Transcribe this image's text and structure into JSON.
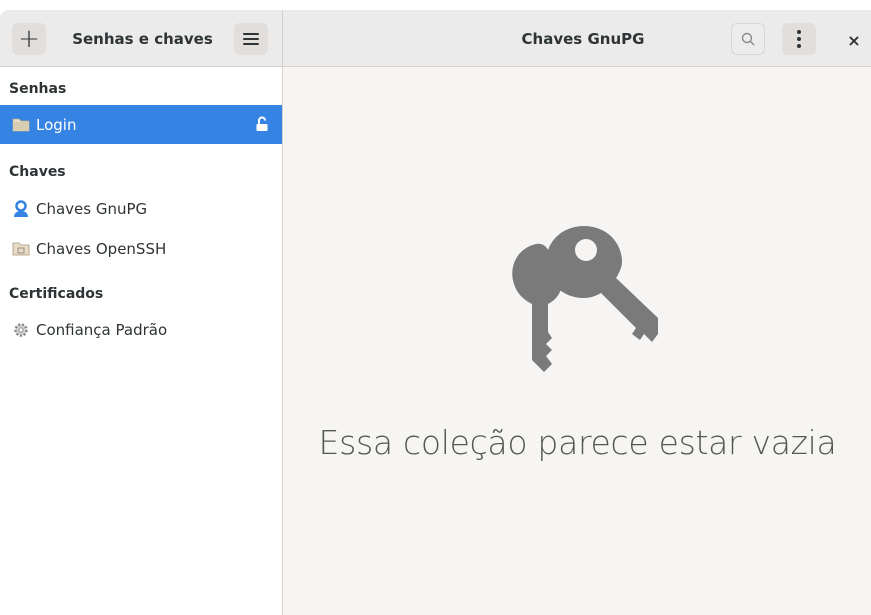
{
  "header": {
    "app_title": "Senhas e chaves",
    "view_title": "Chaves GnuPG",
    "add_label": "+",
    "close_label": "×"
  },
  "sidebar": {
    "sections": [
      {
        "title": "Senhas",
        "items": [
          {
            "label": "Login",
            "icon": "folder-icon",
            "selected": true,
            "locked": false
          }
        ]
      },
      {
        "title": "Chaves",
        "items": [
          {
            "label": "Chaves GnuPG",
            "icon": "person-key-icon"
          },
          {
            "label": "Chaves OpenSSH",
            "icon": "ssh-folder-icon"
          }
        ]
      },
      {
        "title": "Certificados",
        "items": [
          {
            "label": "Confiança Padrão",
            "icon": "gear-icon"
          }
        ]
      }
    ]
  },
  "content": {
    "empty_message": "Essa coleção parece estar vazia",
    "icon": "keys-icon"
  },
  "colors": {
    "accent": "#3584e4",
    "headerbar": "#ebebeb",
    "content_bg": "#f6f5f4",
    "icon_gray": "#7a7a7a"
  }
}
